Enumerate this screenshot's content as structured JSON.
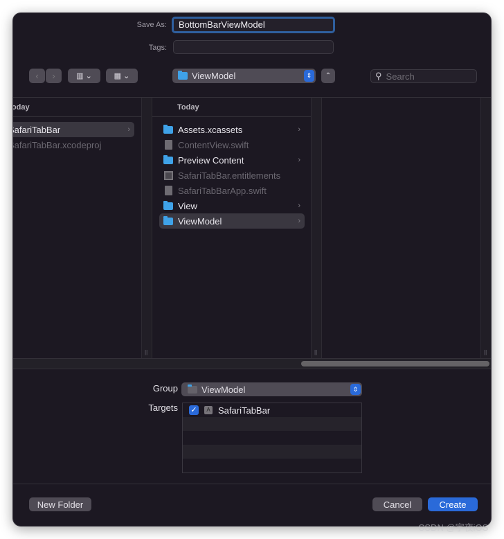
{
  "save_as": {
    "label": "Save As:",
    "value": "BottomBarViewModel"
  },
  "tags": {
    "label": "Tags:",
    "value": ""
  },
  "toolbar": {
    "location": "ViewModel",
    "search_placeholder": "Search"
  },
  "columns": [
    {
      "header": "Today",
      "items": [
        {
          "name": "SafariTabBar",
          "type": "folder",
          "selected": true,
          "enabled": true
        },
        {
          "name": "SafariTabBar.xcodeproj",
          "type": "file",
          "enabled": false
        }
      ]
    },
    {
      "header": "Today",
      "items": [
        {
          "name": "Assets.xcassets",
          "type": "folder",
          "enabled": true
        },
        {
          "name": "ContentView.swift",
          "type": "file",
          "enabled": false
        },
        {
          "name": "Preview Content",
          "type": "folder",
          "enabled": true
        },
        {
          "name": "SafariTabBar.entitlements",
          "type": "entitlements",
          "enabled": false
        },
        {
          "name": "SafariTabBarApp.swift",
          "type": "file",
          "enabled": false
        },
        {
          "name": "View",
          "type": "folder",
          "enabled": true
        },
        {
          "name": "ViewModel",
          "type": "folder",
          "selected": true,
          "enabled": true
        }
      ]
    }
  ],
  "group": {
    "label": "Group",
    "value": "ViewModel"
  },
  "targets": {
    "label": "Targets",
    "items": [
      {
        "name": "SafariTabBar",
        "checked": true
      }
    ]
  },
  "buttons": {
    "new_folder": "New Folder",
    "cancel": "Cancel",
    "create": "Create"
  },
  "watermark": "CSDN @宇夜iOS",
  "colors": {
    "accent": "#2a6ad9",
    "background": "#1c1822",
    "folder": "#3fa2e8"
  }
}
